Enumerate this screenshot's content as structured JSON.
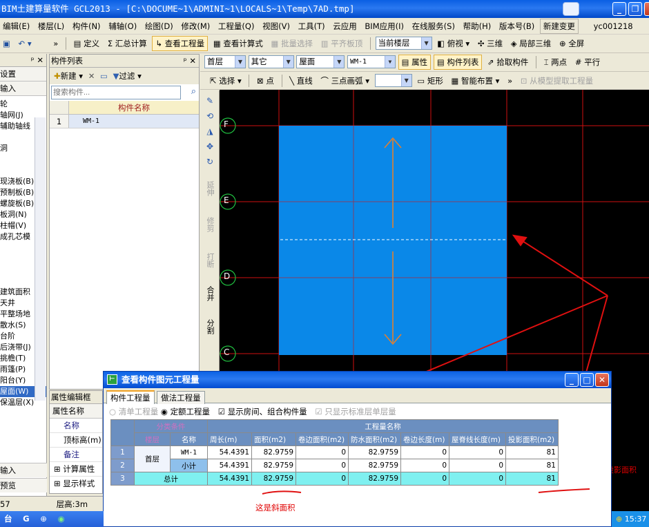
{
  "window": {
    "title": "BIM土建算量软件 GCL2013 - [C:\\DOCUME~1\\ADMINI~1\\LOCALS~1\\Temp\\7AD.tmp]"
  },
  "menu": [
    "编辑(E)",
    "楼层(L)",
    "构件(N)",
    "辅轴(O)",
    "绘图(D)",
    "修改(M)",
    "工程量(Q)",
    "视图(V)",
    "工具(T)",
    "云应用",
    "BIM应用(I)",
    "在线服务(S)",
    "帮助(H)",
    "版本号(B)",
    "新建变更",
    "yc001218"
  ],
  "toolbar1": {
    "define": "定义",
    "calc": "汇总计算",
    "view_qty": "查看工程量",
    "view_formula": "查看计算式",
    "batch_select": "批量选择",
    "align_top": "平齐板顶",
    "current_floor": "当前楼层",
    "top_view": "俯视",
    "three_d": "三维",
    "local_3d": "局部三维",
    "fullscreen": "全屏"
  },
  "toolbar2": {
    "floor": "首层",
    "type": "其它",
    "category": "屋面",
    "component": "WM-1",
    "properties": "属性",
    "component_list": "构件列表",
    "pick": "拾取构件",
    "two_points": "两点",
    "parallel": "平行"
  },
  "toolbar3": {
    "select": "选择",
    "point": "点",
    "line": "直线",
    "arc": "三点画弧",
    "rect": "矩形",
    "smart": "智能布置",
    "extract": "从模型提取工程量"
  },
  "left_panel": {
    "settings": "设置",
    "input": "输入",
    "items": [
      "轮",
      "轴网(J)",
      "辅助轴线",
      "",
      "洞",
      "",
      "",
      "现浇板(B)",
      "预制板(B)",
      "螺旋板(B)",
      "板洞(N)",
      "柱帽(V)",
      "成孔芯模",
      "",
      "",
      "",
      "",
      "建筑面积",
      "天井",
      "平整场地",
      "散水(S)",
      "台阶",
      "后浇带(J)",
      "挑檐(T)",
      "雨篷(P)",
      "阳台(Y)",
      "屋面(W)",
      "保温层(X)"
    ],
    "bottom_input": "输入",
    "preview": "预览"
  },
  "component_list": {
    "title": "构件列表",
    "new": "新建",
    "filter": "过滤",
    "search_placeholder": "搜索构件...",
    "col_name": "构件名称",
    "rows": [
      {
        "no": "1",
        "name": "WM-1"
      }
    ]
  },
  "prop_editor": {
    "title": "属性编辑框",
    "col": "属性名称",
    "rows": [
      "名称",
      "顶标高(m)",
      "备注"
    ],
    "calc_props": "计算属性",
    "display_style": "显示样式"
  },
  "vtools": [
    "延伸",
    "修剪",
    "打断",
    "合并",
    "分割"
  ],
  "axes": [
    "F",
    "E",
    "D",
    "C"
  ],
  "status": {
    "left": "57",
    "floor_height": "层高:3m",
    "clock": "15:37"
  },
  "dialog": {
    "title": "查看构件图元工程量",
    "tabs": [
      "构件工程量",
      "做法工程量"
    ],
    "options": {
      "list_qty": "清单工程量",
      "quota_qty": "定额工程量",
      "show_rooms": "显示房间、组合构件量",
      "std_floor": "只显示标准层单层量"
    },
    "header_group": "分类条件",
    "header_qty": "工程量名称",
    "cols": [
      "楼层",
      "名称",
      "周长(m)",
      "面积(m2)",
      "卷边面积(m2)",
      "防水面积(m2)",
      "卷边长度(m)",
      "屋脊线长度(m)",
      "投影面积(m2)"
    ],
    "rows": [
      {
        "no": "1",
        "floor": "首层",
        "name": "WM-1",
        "vals": [
          "54.4391",
          "82.9759",
          "0",
          "82.9759",
          "0",
          "0",
          "81"
        ]
      },
      {
        "no": "2",
        "floor": "",
        "name": "小计",
        "vals": [
          "54.4391",
          "82.9759",
          "0",
          "82.9759",
          "0",
          "0",
          "81"
        ]
      },
      {
        "no": "3",
        "floor": "",
        "name": "总计",
        "vals": [
          "54.4391",
          "82.9759",
          "0",
          "82.9759",
          "0",
          "0",
          "81"
        ]
      }
    ]
  },
  "annotations": {
    "slope_area": "这是斜面积",
    "projected_area": "这是水平投影面积"
  }
}
